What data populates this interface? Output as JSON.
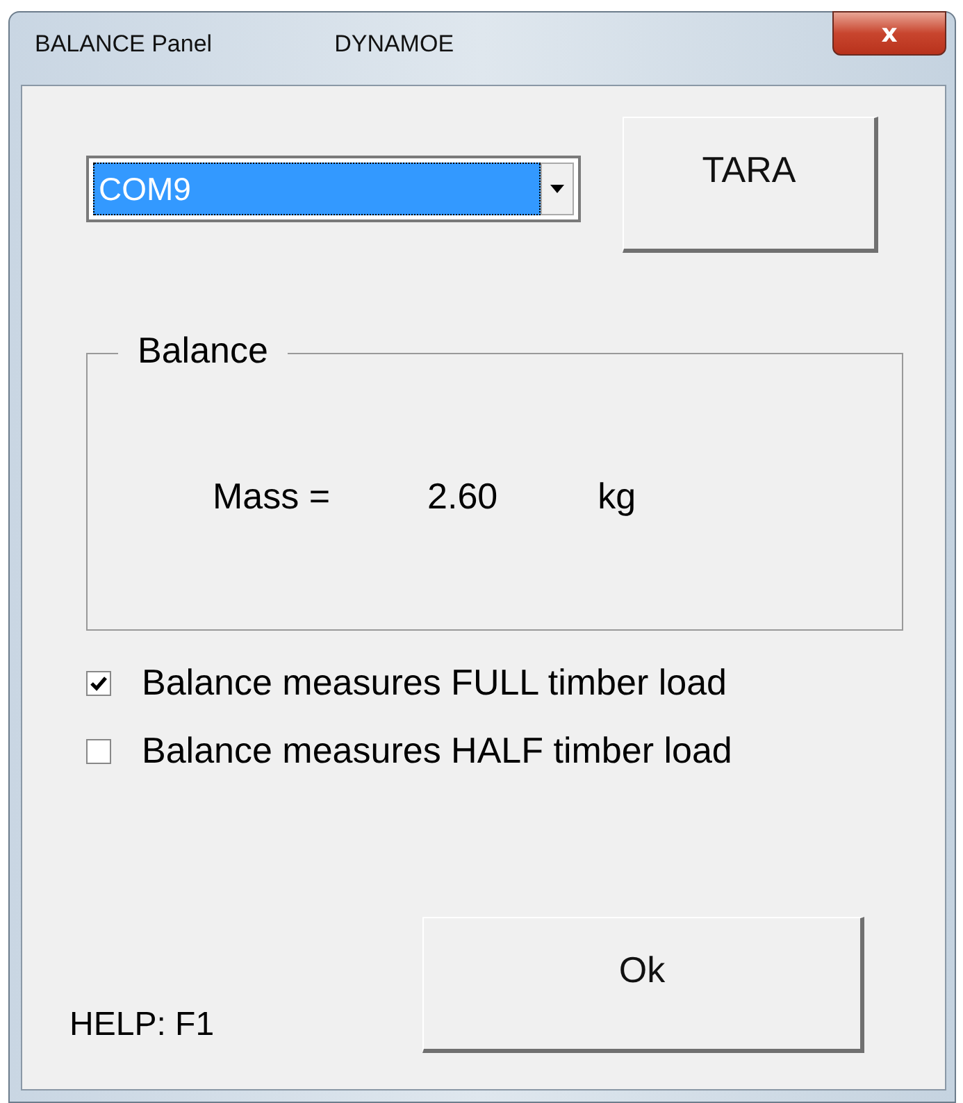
{
  "window": {
    "title": "BALANCE Panel",
    "subtitle": "DYNAMOE",
    "close": "x"
  },
  "port": {
    "value": "COM9"
  },
  "tare_button": "TARA",
  "group": {
    "legend": "Balance",
    "label": "Mass =",
    "value": "2.60",
    "unit": "kg"
  },
  "options": [
    {
      "label": "Balance measures FULL timber load",
      "checked": true
    },
    {
      "label": "Balance measures HALF timber load",
      "checked": false
    }
  ],
  "help": "HELP:  F1",
  "ok_button": "Ok"
}
